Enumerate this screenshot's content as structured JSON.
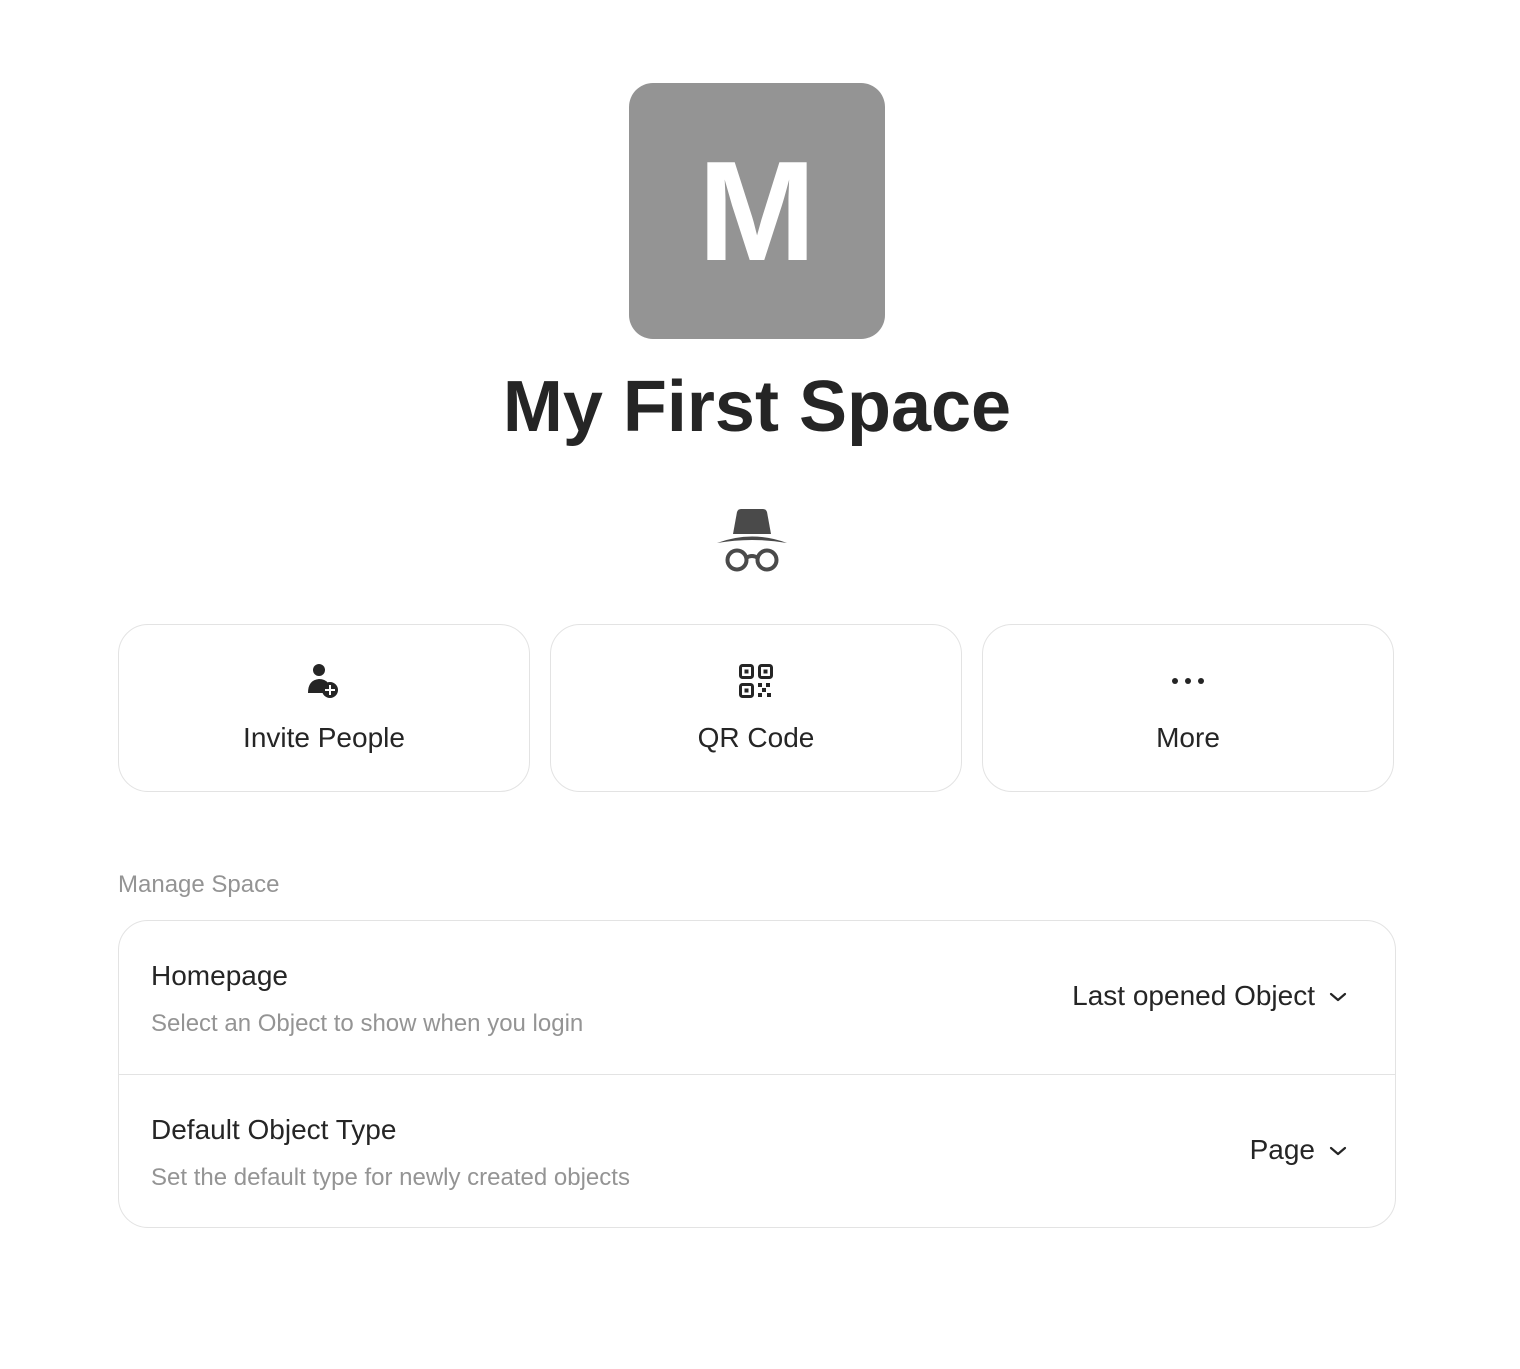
{
  "space": {
    "avatar_letter": "M",
    "name": "My First Space",
    "avatar_color": "#949494",
    "privacy_icon": "incognito-icon"
  },
  "actions": [
    {
      "label": "Invite People",
      "icon": "invite-person-icon"
    },
    {
      "label": "QR Code",
      "icon": "qr-code-icon"
    },
    {
      "label": "More",
      "icon": "more-dots-icon"
    }
  ],
  "manage": {
    "section_label": "Manage Space",
    "settings": [
      {
        "title": "Homepage",
        "description": "Select an Object to show when you login",
        "value": "Last opened Object"
      },
      {
        "title": "Default Object Type",
        "description": "Set the default type for newly created objects",
        "value": "Page"
      }
    ]
  },
  "colors": {
    "text": "#252525",
    "secondary_text": "#949494",
    "border": "#e3e3e3"
  }
}
